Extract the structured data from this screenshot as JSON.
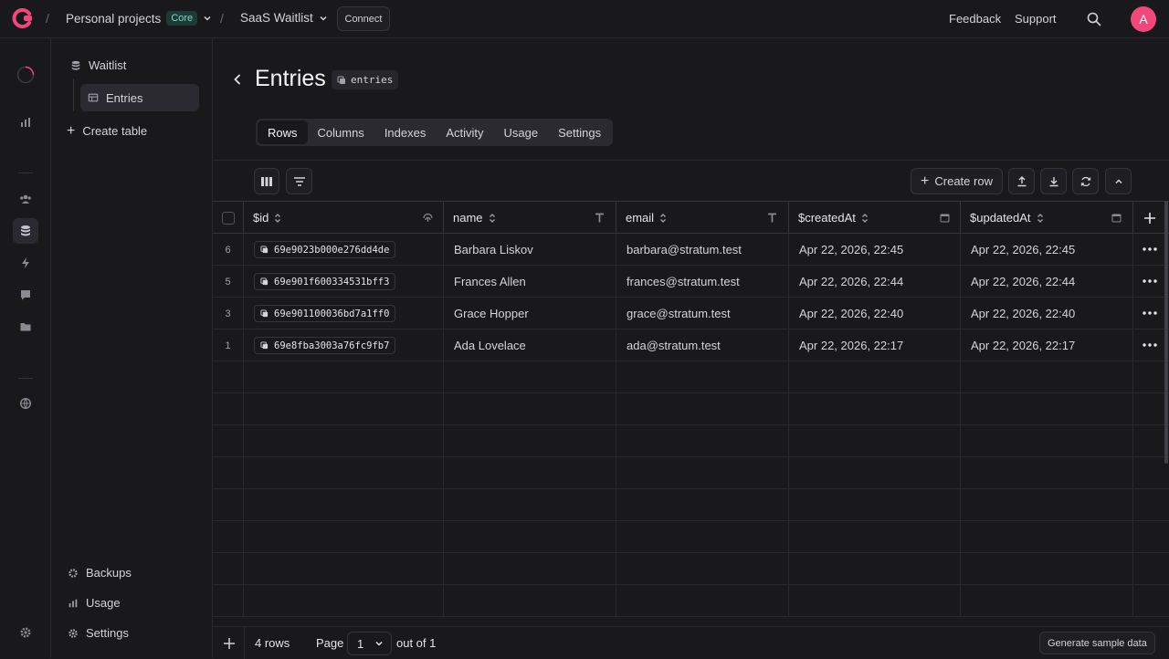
{
  "topbar": {
    "project": "Personal projects",
    "plan_badge": "Core",
    "database": "SaaS Waitlist",
    "connect_label": "Connect",
    "feedback_label": "Feedback",
    "support_label": "Support",
    "avatar_initial": "A"
  },
  "rail": {
    "icons": [
      "loading-spinner-icon",
      "chart-icon",
      "users-icon",
      "database-icon",
      "lightning-icon",
      "message-icon",
      "folder-icon",
      "globe-icon",
      "gear-icon"
    ]
  },
  "sidebar": {
    "database": "Waitlist",
    "table": "Entries",
    "create_table": "Create table",
    "backups": "Backups",
    "usage": "Usage",
    "settings": "Settings"
  },
  "page": {
    "title": "Entries",
    "table_id": "entries",
    "tabs": [
      "Rows",
      "Columns",
      "Indexes",
      "Activity",
      "Usage",
      "Settings"
    ],
    "active_tab": "Rows"
  },
  "toolbar": {
    "create_row": "Create row"
  },
  "table": {
    "columns": [
      {
        "label": "$id"
      },
      {
        "label": "name"
      },
      {
        "label": "email"
      },
      {
        "label": "$createdAt"
      },
      {
        "label": "$updatedAt"
      }
    ],
    "rows": [
      {
        "idx": "6",
        "id": "69e9023b000e276dd4de",
        "name": "Barbara Liskov",
        "email": "barbara@stratum.test",
        "created": "Apr 22, 2026, 22:45",
        "updated": "Apr 22, 2026, 22:45"
      },
      {
        "idx": "5",
        "id": "69e901f600334531bff3",
        "name": "Frances Allen",
        "email": "frances@stratum.test",
        "created": "Apr 22, 2026, 22:44",
        "updated": "Apr 22, 2026, 22:44"
      },
      {
        "idx": "3",
        "id": "69e901100036bd7a1ff0",
        "name": "Grace Hopper",
        "email": "grace@stratum.test",
        "created": "Apr 22, 2026, 22:40",
        "updated": "Apr 22, 2026, 22:40"
      },
      {
        "idx": "1",
        "id": "69e8fba3003a76fc9fb7",
        "name": "Ada Lovelace",
        "email": "ada@stratum.test",
        "created": "Apr 22, 2026, 22:17",
        "updated": "Apr 22, 2026, 22:17"
      }
    ]
  },
  "footer": {
    "row_count": "4 rows",
    "page_label": "Page",
    "page_value": "1",
    "out_of": "out of 1",
    "generate": "Generate sample data"
  },
  "colors": {
    "background": "#19191c",
    "accent": "#f2477b",
    "badge": "#7fd6c2"
  }
}
